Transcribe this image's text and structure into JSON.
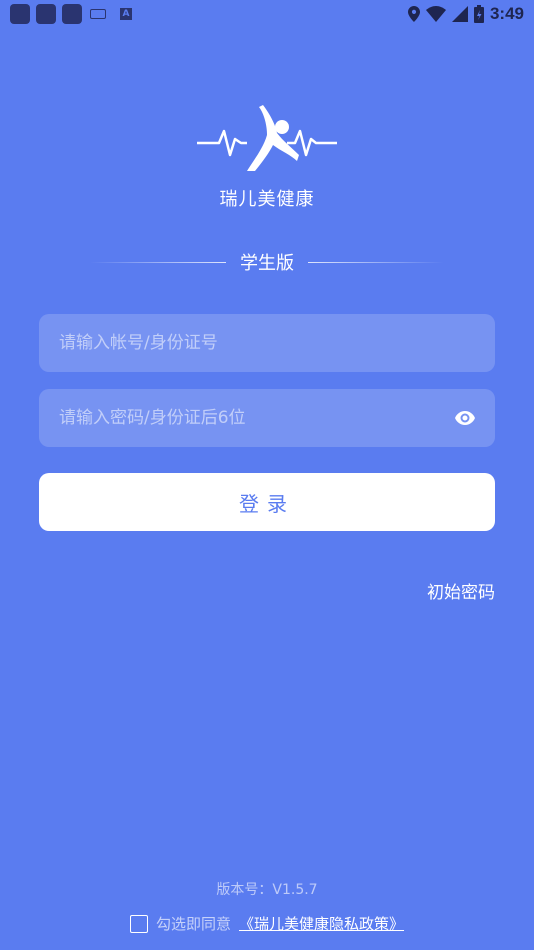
{
  "status_bar": {
    "time": "3:49",
    "icons": [
      "location-icon",
      "wifi-icon",
      "signal-icon",
      "battery-icon"
    ]
  },
  "brand": {
    "name": "瑞儿美健康",
    "logo_icon": "running-person-heartbeat-icon"
  },
  "edition": "学生版",
  "login_form": {
    "account_placeholder": "请输入帐号/身份证号",
    "account_value": "",
    "password_placeholder": "请输入密码/身份证后6位",
    "password_value": "",
    "eye_icon": "eye-icon",
    "login_label": "登录"
  },
  "initial_password_link": "初始密码",
  "footer": {
    "version": "版本号：V1.5.7",
    "agree_text": "勾选即同意",
    "policy_link": "《瑞儿美健康隐私政策》",
    "agree_checked": false
  },
  "colors": {
    "background": "#5a7cf0",
    "button_bg": "#ffffff",
    "button_text": "#5a7cf0"
  }
}
